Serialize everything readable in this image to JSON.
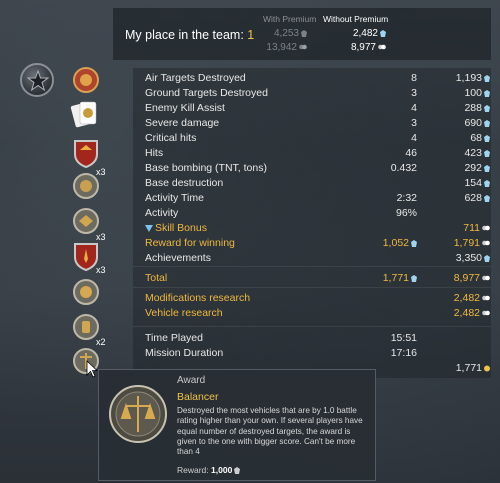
{
  "header": {
    "col_premium": "With Premium",
    "col_no_premium": "Without Premium",
    "place_label": "My place in the team:",
    "place_value": "1",
    "sl_premium": "4,253",
    "sl_no_premium": "2,482",
    "rp_premium": "13,942",
    "rp_no_premium": "8,977"
  },
  "rows": [
    {
      "label": "Air Targets Destroyed",
      "v1": "8",
      "v2": "1,193",
      "icon": "sl"
    },
    {
      "label": "Ground Targets Destroyed",
      "v1": "3",
      "v2": "100",
      "icon": "sl"
    },
    {
      "label": "Enemy Kill Assist",
      "v1": "4",
      "v2": "288",
      "icon": "sl"
    },
    {
      "label": "Severe damage",
      "v1": "3",
      "v2": "690",
      "icon": "sl"
    },
    {
      "label": "Critical hits",
      "v1": "4",
      "v2": "68",
      "icon": "sl"
    },
    {
      "label": "Hits",
      "v1": "46",
      "v2": "423",
      "icon": "sl"
    },
    {
      "label": "Base bombing (TNT, tons)",
      "v1": "0.432",
      "v2": "292",
      "icon": "sl"
    },
    {
      "label": "Base destruction",
      "v1": "",
      "v2": "154",
      "icon": "sl"
    },
    {
      "label": "Activity Time",
      "v1": "2:32",
      "v2": "628",
      "icon": "sl"
    },
    {
      "label": "Activity",
      "v1": "96%",
      "v2": "",
      "icon": ""
    },
    {
      "label": "Skill Bonus",
      "v1": "",
      "v2": "711",
      "icon": "rp"
    },
    {
      "label": "Reward for winning",
      "v1": "1,052",
      "v2": "1,791",
      "icon": "rp"
    },
    {
      "label": "Achievements",
      "v1": "",
      "v2": "3,350",
      "icon": "sl"
    },
    {
      "label": "Total",
      "v1": "1,771",
      "v2": "8,977",
      "icon": "rp"
    },
    {
      "label": "Modifications research",
      "v1": "",
      "v2": "2,482",
      "icon": "rp"
    },
    {
      "label": "Vehicle research",
      "v1": "",
      "v2": "2,482",
      "icon": "rp"
    },
    {
      "label": "Time Played",
      "v1": "15:51",
      "v2": "",
      "icon": ""
    },
    {
      "label": "Mission Duration",
      "v1": "17:16",
      "v2": "",
      "icon": ""
    },
    {
      "label": "",
      "v1": "",
      "v2": "1,771",
      "icon": "gold"
    }
  ],
  "awards_multipliers": [
    "x3",
    "x3",
    "x3",
    "x2"
  ],
  "tooltip": {
    "title": "Award",
    "name": "Balancer",
    "description": "Destroyed the most vehicles that are by 1.0 battle rating higher than your own. If several players have equal number of destroyed targets, the award is given to the one with bigger score. Can't be more than 4",
    "reward_label": "Reward:",
    "reward_value": "1,000"
  },
  "colors": {
    "gold": "#f0b840",
    "accent": "#f0c14b",
    "text": "#e8e8e8"
  }
}
